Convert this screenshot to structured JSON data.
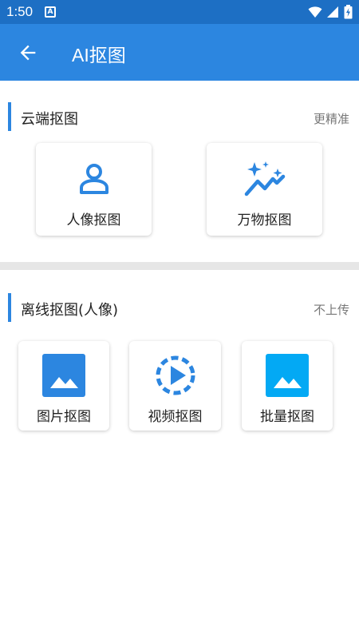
{
  "status_bar": {
    "time": "1:50",
    "notification_badge": "A",
    "icons": [
      "wifi-icon",
      "signal-icon",
      "battery-icon"
    ]
  },
  "app_bar": {
    "title": "AI抠图",
    "back_icon": "back-arrow-icon"
  },
  "cloud_section": {
    "title": "云端抠图",
    "hint": "更精准",
    "items": [
      {
        "label": "人像抠图",
        "icon": "person-icon"
      },
      {
        "label": "万物抠图",
        "icon": "sparkle-chart-icon"
      }
    ]
  },
  "offline_section": {
    "title": "离线抠图(人像)",
    "hint": "不上传",
    "items": [
      {
        "label": "图片抠图",
        "icon": "image-icon"
      },
      {
        "label": "视频抠图",
        "icon": "video-play-icon"
      },
      {
        "label": "批量抠图",
        "icon": "batch-image-icon"
      }
    ]
  },
  "colors": {
    "primary": "#2c86e0",
    "status_bar": "#1d6fc4",
    "light_blue": "#03a9f4",
    "divider": "#e6e6e6"
  }
}
